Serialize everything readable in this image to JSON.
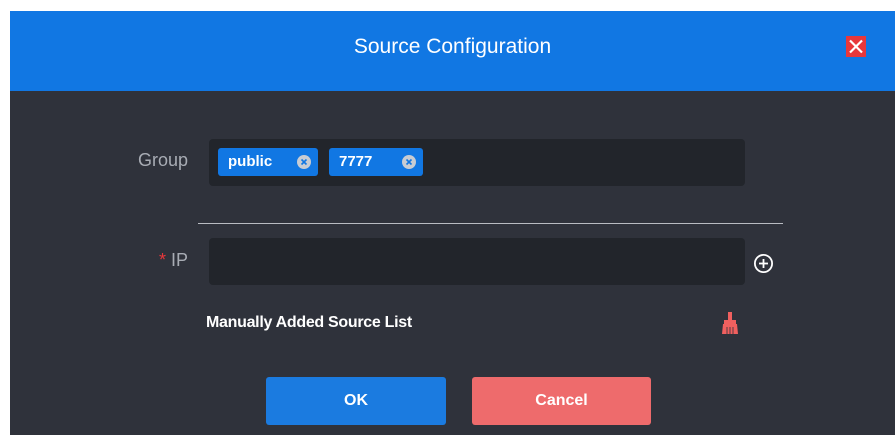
{
  "dialog": {
    "title": "Source Configuration"
  },
  "form": {
    "group_label": "Group",
    "group_tags": [
      "public",
      "7777"
    ],
    "ip_required_marker": "*",
    "ip_label": "IP",
    "ip_value": "",
    "ip_placeholder": "",
    "manual_list_label": "Manually Added Source List"
  },
  "buttons": {
    "ok_label": "OK",
    "cancel_label": "Cancel"
  },
  "icons": {
    "close": "close-icon",
    "tag_remove": "circle-x-icon",
    "add": "circle-plus-icon",
    "clear": "broom-icon"
  },
  "colors": {
    "titlebar": "#1177e3",
    "dialog_bg": "#2f323b",
    "field_bg": "#22252b",
    "tag_bg": "#1177e3",
    "ok": "#1b7be0",
    "cancel": "#ee6b6c",
    "danger": "#e8373b",
    "broom": "#f0605f"
  }
}
